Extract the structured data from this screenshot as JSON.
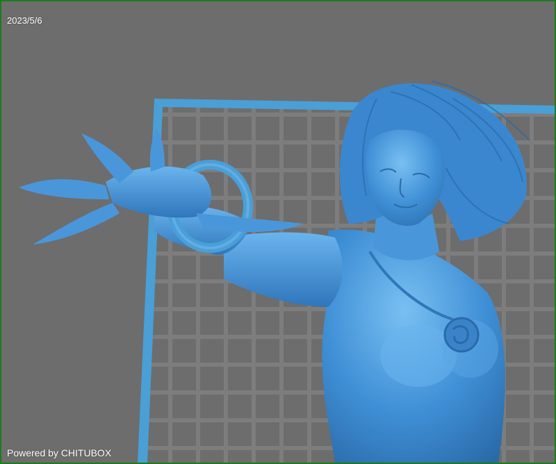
{
  "viewer": {
    "date": "2023/5/6",
    "powered_by": "Powered by CHITUBOX"
  },
  "colors": {
    "background": "#6d6d6d",
    "frame_border": "#1f7a1f",
    "build_plate_grid": "#7a7a7a",
    "build_plate_edge": "#4a9fd6",
    "model": "#3f8fd6",
    "model_highlight": "#6ab4ee",
    "model_shadow": "#2a6aa8"
  }
}
